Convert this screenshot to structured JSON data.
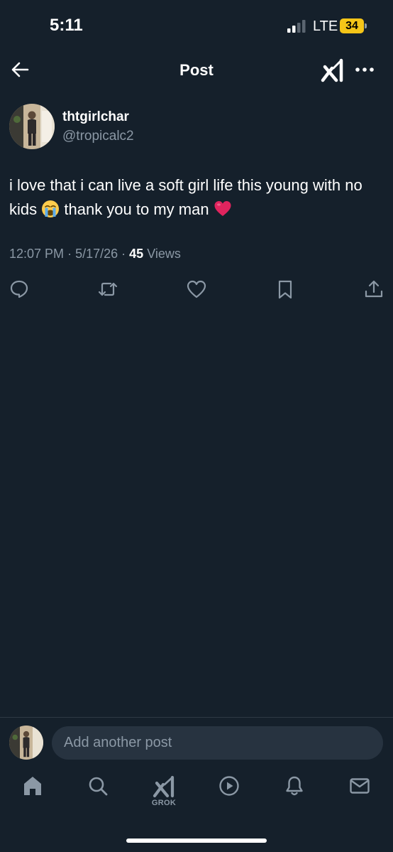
{
  "status_bar": {
    "time": "5:11",
    "network": "LTE",
    "battery": "34"
  },
  "header": {
    "title": "Post"
  },
  "post": {
    "display_name": "thtgirlchar",
    "handle": "@tropicalc2",
    "text_part1": "i love that i can live a soft girl life this young with no kids",
    "text_part2": "thank you to my man",
    "emoji_1": "loudly-crying-face",
    "emoji_2": "red-heart",
    "time": "12:07 PM",
    "date": "5/17/26",
    "views_count": "45",
    "views_label": "Views"
  },
  "compose": {
    "placeholder": "Add another post"
  },
  "tab_bar": {
    "grok_label": "GROK"
  },
  "colors": {
    "background": "#15202b",
    "secondary_text": "#8b98a5",
    "input_background": "#273340",
    "battery": "#f5c518",
    "heart": "#e0245e"
  }
}
